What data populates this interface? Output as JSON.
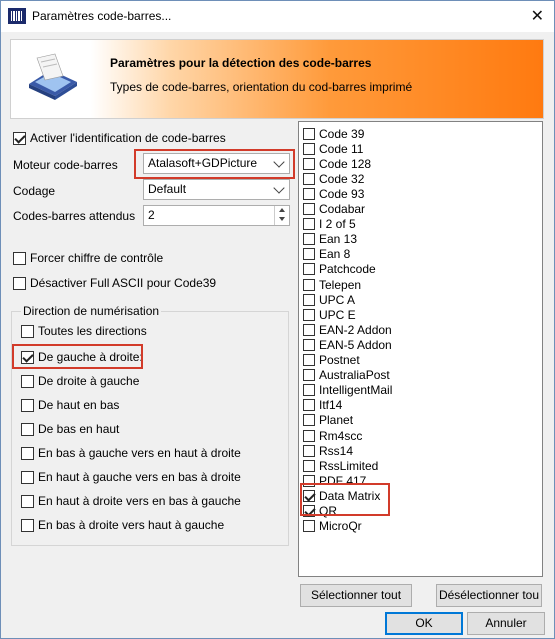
{
  "window": {
    "title": "Paramètres code-barres..."
  },
  "header": {
    "title": "Paramètres pour la détection des code-barres",
    "subtitle": "Types de code-barres, orientation du cod-barres imprimé"
  },
  "options": {
    "enable_label": "Activer l'identification de code-barres",
    "enable_checked": true,
    "engine_label": "Moteur code-barres",
    "engine_value": "Atalasoft+GDPicture",
    "encoding_label": "Codage",
    "encoding_value": "Default",
    "expected_label": "Codes-barres attendus",
    "expected_value": "2",
    "force_check_label": "Forcer chiffre de contrôle",
    "force_check_checked": false,
    "disable_ascii_label": "Désactiver Full ASCII pour Code39",
    "disable_ascii_checked": false
  },
  "direction": {
    "title": "Direction de numérisation",
    "items": [
      {
        "label": "Toutes les directions",
        "checked": false
      },
      {
        "label": "De gauche à droite:",
        "checked": true
      },
      {
        "label": "De droite à gauche",
        "checked": false
      },
      {
        "label": "De haut en bas",
        "checked": false
      },
      {
        "label": "De bas en haut",
        "checked": false
      },
      {
        "label": "En bas à gauche vers en haut à droite",
        "checked": false
      },
      {
        "label": "En haut à gauche vers en bas à droite",
        "checked": false
      },
      {
        "label": "En haut à droite vers en bas à gauche",
        "checked": false
      },
      {
        "label": "En bas à droite vers haut à gauche",
        "checked": false
      }
    ]
  },
  "barcode_types": [
    {
      "label": "Code 39",
      "checked": false
    },
    {
      "label": "Code 11",
      "checked": false
    },
    {
      "label": "Code 128",
      "checked": false
    },
    {
      "label": "Code 32",
      "checked": false
    },
    {
      "label": "Code 93",
      "checked": false
    },
    {
      "label": "Codabar",
      "checked": false
    },
    {
      "label": "I 2 of 5",
      "checked": false
    },
    {
      "label": "Ean 13",
      "checked": false
    },
    {
      "label": "Ean 8",
      "checked": false
    },
    {
      "label": "Patchcode",
      "checked": false
    },
    {
      "label": "Telepen",
      "checked": false
    },
    {
      "label": "UPC A",
      "checked": false
    },
    {
      "label": "UPC E",
      "checked": false
    },
    {
      "label": "EAN-2 Addon",
      "checked": false
    },
    {
      "label": "EAN-5 Addon",
      "checked": false
    },
    {
      "label": "Postnet",
      "checked": false
    },
    {
      "label": "AustraliaPost",
      "checked": false
    },
    {
      "label": "IntelligentMail",
      "checked": false
    },
    {
      "label": "Itf14",
      "checked": false
    },
    {
      "label": "Planet",
      "checked": false
    },
    {
      "label": "Rm4scc",
      "checked": false
    },
    {
      "label": "Rss14",
      "checked": false
    },
    {
      "label": "RssLimited",
      "checked": false
    },
    {
      "label": "PDF 417",
      "checked": false
    },
    {
      "label": "Data Matrix",
      "checked": true
    },
    {
      "label": "QR",
      "checked": true
    },
    {
      "label": "MicroQr",
      "checked": false
    }
  ],
  "buttons": {
    "select_all": "Sélectionner tout",
    "deselect_all": "Désélectionner tou",
    "ok": "OK",
    "cancel": "Annuler"
  },
  "colors": {
    "highlight": "#d23b2a",
    "header_accent": "#ff7a10"
  }
}
